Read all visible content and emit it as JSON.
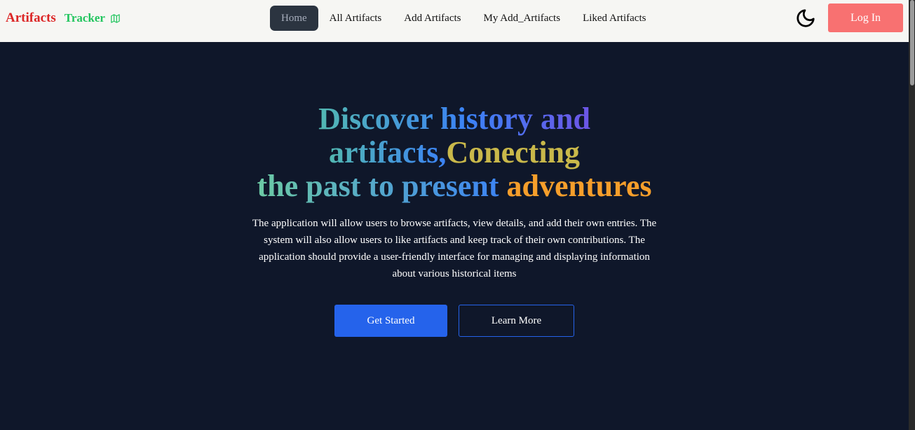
{
  "brand": {
    "name": "Artifacts",
    "sub": "Tracker",
    "icon": "map-icon",
    "name_color": "#dc2626",
    "sub_color": "#22c55e"
  },
  "nav": {
    "items": [
      {
        "label": "Home",
        "active": true
      },
      {
        "label": "All Artifacts",
        "active": false
      },
      {
        "label": "Add Artifacts",
        "active": false
      },
      {
        "label": "My Add_Artifacts",
        "active": false
      },
      {
        "label": "Liked Artifacts",
        "active": false
      }
    ]
  },
  "theme_toggle": {
    "icon": "moon-icon"
  },
  "login": {
    "label": "Log In",
    "color": "#f87171"
  },
  "hero": {
    "title": {
      "line1_a": "Discover history and",
      "line2_a": "artifacts,",
      "line2_b": "Conecting",
      "line3_a": "the past to present ",
      "line3_b": "adventures"
    },
    "description": "The application will allow users to browse artifacts, view details, and add their own entries. The system will also allow users to like artifacts and keep track of their own contributions. The application should provide a user-friendly interface for managing and displaying information about various historical items",
    "primary_button": "Get Started",
    "secondary_button": "Learn More"
  },
  "colors": {
    "background": "#0f172a",
    "navbar": "#f6f6f3",
    "accent_blue": "#2563eb",
    "gold": "#c9b84a",
    "orange": "#f59e2b"
  }
}
